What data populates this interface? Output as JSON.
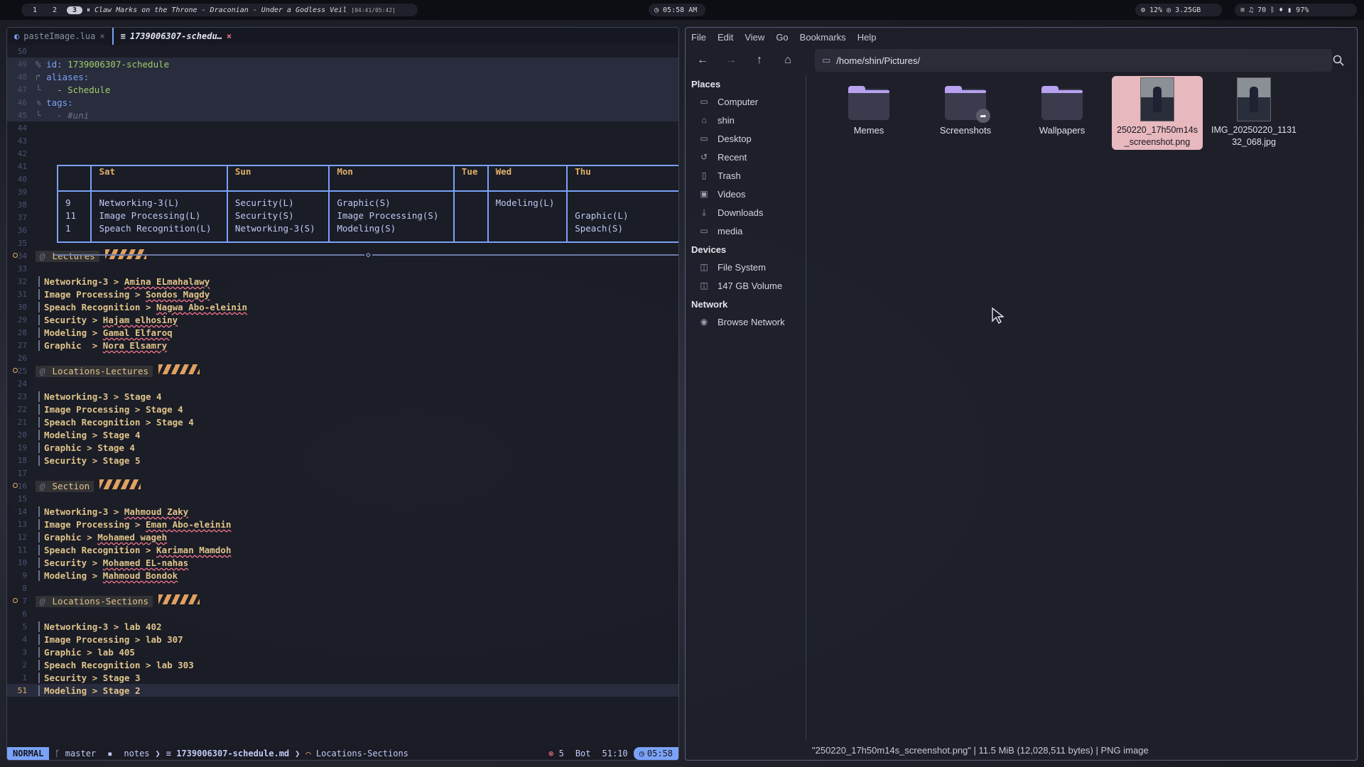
{
  "topbar": {
    "workspaces": [
      "1",
      "2",
      "3"
    ],
    "song": "Claw Marks on the Throne - Draconian - Under a Godless Veil",
    "song_time": "[04:41/05:42]",
    "clock": "05:58 AM",
    "cpu": "12%",
    "mem": "3.25GB",
    "volume": "70",
    "battery": "97%"
  },
  "editor": {
    "tabs": [
      {
        "label": "pasteImage.lua",
        "close": "×"
      },
      {
        "label": "1739006307-schedu…",
        "close": "×"
      }
    ],
    "frontmatter": {
      "id_key": "id:",
      "id_val": "1739006307-schedule",
      "aliases_key": "aliases:",
      "alias_item": "- Schedule",
      "tags_key": "tags:",
      "tag_item": "- #uni"
    },
    "table": {
      "headers": [
        "",
        "Sat",
        "Sun",
        "Mon",
        "Tue",
        "Wed",
        "Thu"
      ],
      "cells": [
        "9\n11\n1",
        "Networking-3(L)\nImage Processing(L)\nSpeach Recognition(L)",
        "Security(L)\nSecurity(S)\nNetworking-3(S)",
        "Graphic(S)\nImage Processing(S)\nModeling(S)",
        "",
        "Modeling(L)",
        "\nGraphic(L)\nSpeach(S)"
      ]
    },
    "sections": [
      {
        "title": "Lectures",
        "lines": [
          [
            "Networking-3 > ",
            "Amina ELmahalawy"
          ],
          [
            "Image Processing > ",
            "Sondos Magdy"
          ],
          [
            "Speach Recognition > ",
            "Nagwa Abo-eleinin"
          ],
          [
            "Security > ",
            "Hajam elhosiny"
          ],
          [
            "Modeling > ",
            "Gamal Elfaroq"
          ],
          [
            "Graphic  > ",
            "Nora Elsamry"
          ]
        ]
      },
      {
        "title": "Locations-Lectures",
        "lines": [
          [
            "Networking-3 > ",
            "Stage 4"
          ],
          [
            "Image Processing > ",
            "Stage 4"
          ],
          [
            "Speach Recognition > ",
            "Stage 4"
          ],
          [
            "Modeling > ",
            "Stage 4"
          ],
          [
            "Graphic > ",
            "Stage 4"
          ],
          [
            "Security > ",
            "Stage 5"
          ]
        ]
      },
      {
        "title": "Section",
        "lines": [
          [
            "Networking-3 > ",
            "Mahmoud Zaky"
          ],
          [
            "Image Processing > ",
            "Eman Abo-eleinin"
          ],
          [
            "Graphic > ",
            "Mohamed wageh"
          ],
          [
            "Speach Recognition > ",
            "Kariman Mamdoh"
          ],
          [
            "Security > ",
            "Mohamed EL-nahas"
          ],
          [
            "Modeling > ",
            "Mahmoud Bondok"
          ]
        ]
      },
      {
        "title": "Locations-Sections",
        "lines": [
          [
            "Networking-3 > ",
            "lab 402"
          ],
          [
            "Image Processing > ",
            "lab 307"
          ],
          [
            "Graphic > ",
            "lab 405"
          ],
          [
            "Speach Recognition > ",
            "lab 303"
          ],
          [
            "Security > ",
            "Stage 3"
          ],
          [
            "Modeling > ",
            "Stage 2"
          ]
        ]
      }
    ],
    "line_numbers": [
      "50",
      "49",
      "48",
      "47",
      "46",
      "45",
      "44",
      "43",
      "42",
      "41",
      "40",
      "39",
      "38",
      "37",
      "36",
      "35",
      "34",
      "33",
      "32",
      "31",
      "30",
      "29",
      "28",
      "27",
      "26",
      "25",
      "24",
      "23",
      "22",
      "21",
      "20",
      "19",
      "18",
      "17",
      "16",
      "15",
      "14",
      "13",
      "12",
      "11",
      "10",
      "9",
      "8",
      "7",
      "6",
      "5",
      "4",
      "3",
      "2",
      "1",
      "51"
    ],
    "status": {
      "mode": "NORMAL",
      "branch": "master",
      "dir": "notes",
      "file": "1739006307-schedule.md",
      "symbol": "Locations-Sections",
      "diag": "5",
      "pos_word": "Bot",
      "pos": "51:10",
      "time": "05:58"
    }
  },
  "filemanager": {
    "menu": [
      "File",
      "Edit",
      "View",
      "Go",
      "Bookmarks",
      "Help"
    ],
    "path": "/home/shin/Pictures/",
    "places_header": "Places",
    "places": [
      "Computer",
      "shin",
      "Desktop",
      "Recent",
      "Trash",
      "Videos",
      "Downloads",
      "media"
    ],
    "devices_header": "Devices",
    "devices": [
      "File System",
      "147 GB Volume"
    ],
    "network_header": "Network",
    "network": [
      "Browse Network"
    ],
    "files": [
      {
        "name": "Memes",
        "kind": "folder"
      },
      {
        "name": "Screenshots",
        "kind": "folder-link"
      },
      {
        "name": "Wallpapers",
        "kind": "folder"
      },
      {
        "name": "250220_17h50m14s_screenshot.png",
        "kind": "image",
        "selected": true
      },
      {
        "name": "IMG_20250220_113132_068.jpg",
        "kind": "image"
      }
    ],
    "statusbar": "\"250220_17h50m14s_screenshot.png\" | 11.5 MiB (12,028,511 bytes) | PNG image"
  }
}
